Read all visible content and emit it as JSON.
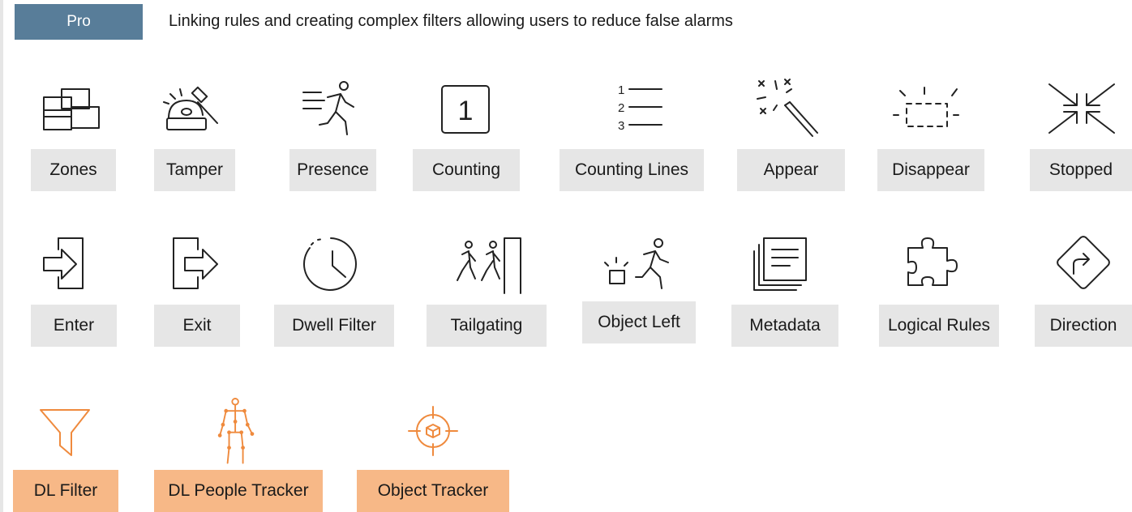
{
  "header": {
    "badge": "Pro",
    "description": "Linking rules and creating complex filters allowing users to reduce false alarms"
  },
  "features": {
    "zones": {
      "label": "Zones",
      "icon": "zones-icon"
    },
    "tamper": {
      "label": "Tamper",
      "icon": "tamper-icon"
    },
    "presence": {
      "label": "Presence",
      "icon": "presence-icon"
    },
    "counting": {
      "label": "Counting",
      "icon": "counting-icon",
      "digit": "1"
    },
    "counting_lines": {
      "label": "Counting Lines",
      "icon": "counting-lines-icon",
      "numbers": [
        "1",
        "2",
        "3"
      ]
    },
    "appear": {
      "label": "Appear",
      "icon": "magic-wand-icon"
    },
    "disappear": {
      "label": "Disappear",
      "icon": "dashed-box-icon"
    },
    "stopped": {
      "label": "Stopped",
      "icon": "converging-arrows-icon"
    },
    "enter": {
      "label": "Enter",
      "icon": "enter-icon"
    },
    "exit": {
      "label": "Exit",
      "icon": "exit-icon"
    },
    "dwell_filter": {
      "label": "Dwell Filter",
      "icon": "clock-icon"
    },
    "tailgating": {
      "label": "Tailgating",
      "icon": "tailgating-icon"
    },
    "object_left": {
      "label": "Object Left",
      "icon": "object-left-icon"
    },
    "metadata": {
      "label": "Metadata",
      "icon": "metadata-icon"
    },
    "logical_rules": {
      "label": "Logical Rules",
      "icon": "puzzle-icon"
    },
    "direction": {
      "label": "Direction",
      "icon": "direction-sign-icon"
    },
    "dl_filter": {
      "label": "DL Filter",
      "icon": "funnel-icon"
    },
    "dl_people_tracker": {
      "label": "DL People Tracker",
      "icon": "skeleton-icon"
    },
    "object_tracker": {
      "label": "Object Tracker",
      "icon": "crosshair-cube-icon"
    }
  },
  "colors": {
    "badge": "#587d99",
    "label_bg": "#e6e6e6",
    "dl_label_bg": "#f7b887",
    "dl_icon": "#ef8a3d",
    "icon": "#222222"
  }
}
